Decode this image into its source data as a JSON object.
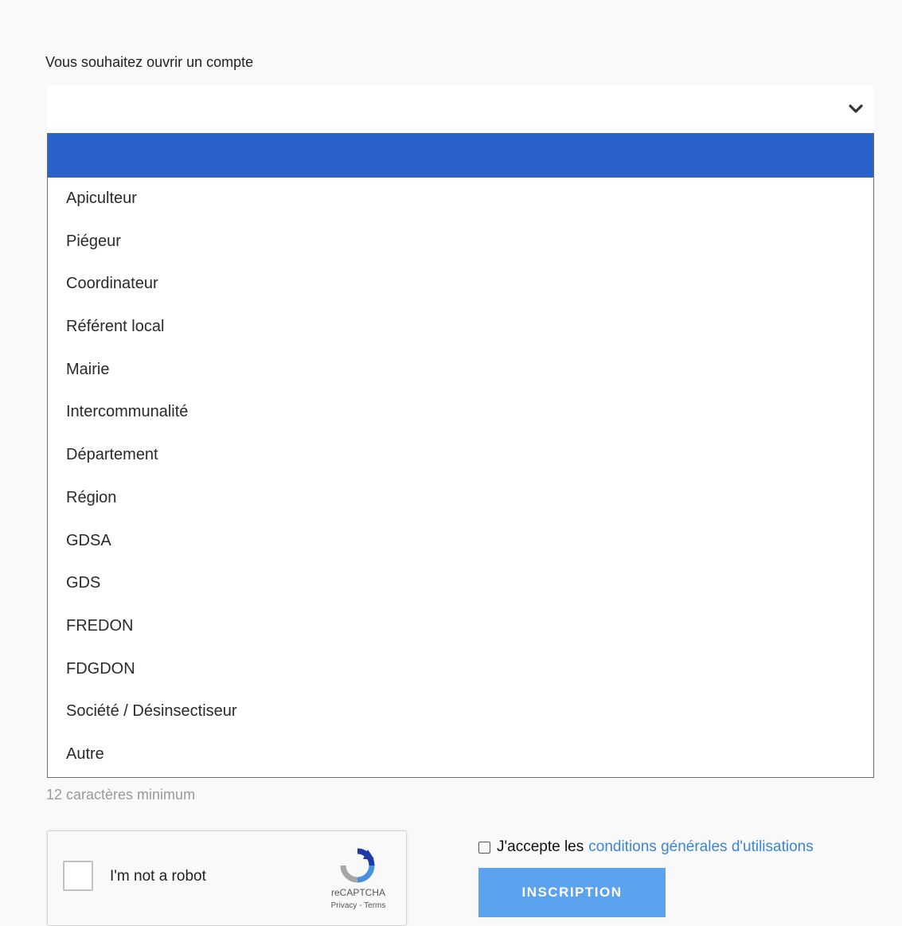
{
  "account_form": {
    "label": "Vous souhaitez ouvrir un compte",
    "selected_value": "",
    "options": [
      "",
      "Apiculteur",
      "Piégeur",
      "Coordinateur",
      "Référent local",
      "Mairie",
      "Intercommunalité",
      "Département",
      "Région",
      "GDSA",
      "GDS",
      "FREDON",
      "FDGDON",
      "Société / Désinsectiseur",
      "Autre"
    ],
    "highlight_color": "#2a62cc"
  },
  "password_hint": "12 caractères minimum",
  "recaptcha": {
    "label": "I'm not a robot",
    "brand": "reCAPTCHA",
    "links": "Privacy - Terms"
  },
  "terms": {
    "prefix": "J'accepte les",
    "link_text": "conditions générales d'utilisations",
    "link_color": "#3a86d4"
  },
  "submit": {
    "label": "INSCRIPTION",
    "color": "#5ba3ee"
  }
}
